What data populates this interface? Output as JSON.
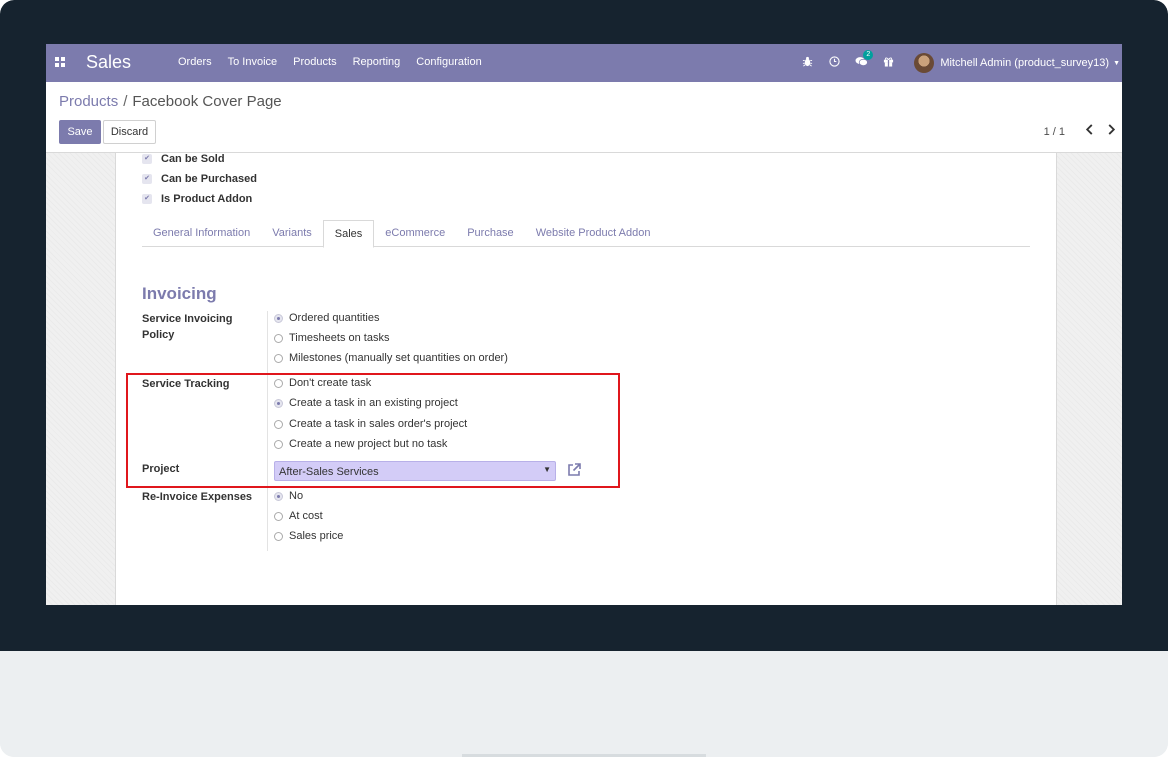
{
  "navbar": {
    "brand": "Sales",
    "menu": [
      "Orders",
      "To Invoice",
      "Products",
      "Reporting",
      "Configuration"
    ],
    "message_count": "2",
    "user_name": "Mitchell Admin (product_survey13)"
  },
  "breadcrumb": {
    "parent": "Products",
    "separator": "/",
    "current": "Facebook Cover Page"
  },
  "actions": {
    "save": "Save",
    "discard": "Discard"
  },
  "pager": {
    "value": "1 / 1"
  },
  "checkboxes": [
    {
      "label": "Can be Sold",
      "checked": true
    },
    {
      "label": "Can be Purchased",
      "checked": true
    },
    {
      "label": "Is Product Addon",
      "checked": true
    }
  ],
  "tabs": [
    "General Information",
    "Variants",
    "Sales",
    "eCommerce",
    "Purchase",
    "Website Product Addon"
  ],
  "active_tab": "Sales",
  "section": {
    "title": "Invoicing"
  },
  "fields": {
    "service_invoicing_policy": {
      "label_line1": "Service Invoicing",
      "label_line2": "Policy",
      "options": [
        "Ordered quantities",
        "Timesheets on tasks",
        "Milestones (manually set quantities on order)"
      ],
      "selected": "Ordered quantities"
    },
    "service_tracking": {
      "label": "Service Tracking",
      "options": [
        "Don't create task",
        "Create a task in an existing project",
        "Create a task in sales order's project",
        "Create a new project but no task"
      ],
      "selected": "Create a task in an existing project"
    },
    "project": {
      "label": "Project",
      "value": "After-Sales Services"
    },
    "reinvoice_expenses": {
      "label": "Re-Invoice Expenses",
      "options": [
        "No",
        "At cost",
        "Sales price"
      ],
      "selected": "No"
    }
  },
  "colors": {
    "brand": "#7c7bad",
    "highlight": "#e0161c",
    "select_bg": "#d3ccf7",
    "frame": "#16232f"
  }
}
